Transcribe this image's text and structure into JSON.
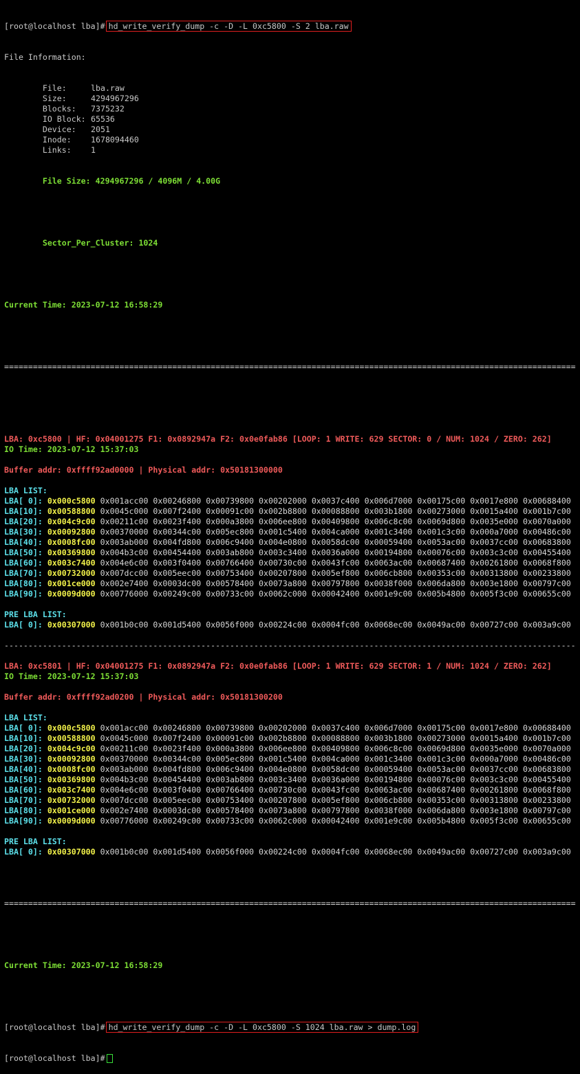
{
  "prompt": "[root@localhost lba]#",
  "command1": "hd_write_verify_dump -c -D -L 0xc5800 -S 2 lba.raw",
  "command2": "hd_write_verify_dump -c -D -L 0xc5800 -S 1024 lba.raw > dump.log",
  "file_info": {
    "header": "File Information:",
    "rows": [
      {
        "label": "        File:",
        "value": "lba.raw"
      },
      {
        "label": "        Size:",
        "value": "4294967296"
      },
      {
        "label": "        Blocks:",
        "value": "7375232"
      },
      {
        "label": "        IO Block:",
        "value": "65536"
      },
      {
        "label": "        Device:",
        "value": "2051"
      },
      {
        "label": "        Inode:",
        "value": "1678094460"
      },
      {
        "label": "        Links:",
        "value": "1"
      }
    ],
    "file_size": "        File Size: 4294967296 / 4096M / 4.00G",
    "sector_per_cluster": "        Sector_Per_Cluster: 1024"
  },
  "current_time": "Current Time: 2023-07-12 16:58:29",
  "separator_eq": "=======================================================================================================================",
  "separator_dash": "-----------------------------------------------------------------------------------------------------------------------",
  "lba_list_label": "LBA LIST:",
  "pre_lba_list_label": "PRE LBA LIST:",
  "lba_row_labels": [
    "LBA[ 0]:",
    "LBA[10]:",
    "LBA[20]:",
    "LBA[30]:",
    "LBA[40]:",
    "LBA[50]:",
    "LBA[60]:",
    "LBA[70]:",
    "LBA[80]:",
    "LBA[90]:"
  ],
  "lba_rows": [
    [
      "0x000c5800",
      "0x001acc00",
      "0x00246800",
      "0x00739800",
      "0x00202000",
      "0x0037c400",
      "0x006d7000",
      "0x00175c00",
      "0x0017e800",
      "0x00688400"
    ],
    [
      "0x00588800",
      "0x0045c000",
      "0x007f2400",
      "0x00091c00",
      "0x002b8800",
      "0x00088800",
      "0x003b1800",
      "0x00273000",
      "0x0015a400",
      "0x001b7c00"
    ],
    [
      "0x004c9c00",
      "0x00211c00",
      "0x0023f400",
      "0x000a3800",
      "0x006ee800",
      "0x00409800",
      "0x006c8c00",
      "0x0069d800",
      "0x0035e000",
      "0x0070a000"
    ],
    [
      "0x00092800",
      "0x00370000",
      "0x00344c00",
      "0x005ec800",
      "0x001c5400",
      "0x004ca000",
      "0x001c3400",
      "0x001c3c00",
      "0x000a7000",
      "0x00486c00"
    ],
    [
      "0x0008fc00",
      "0x003ab000",
      "0x004fd800",
      "0x006c9400",
      "0x004e0800",
      "0x0058dc00",
      "0x00059400",
      "0x0053ac00",
      "0x0037cc00",
      "0x00683800"
    ],
    [
      "0x00369800",
      "0x004b3c00",
      "0x00454400",
      "0x003ab800",
      "0x003c3400",
      "0x0036a000",
      "0x00194800",
      "0x00076c00",
      "0x003c3c00",
      "0x00455400"
    ],
    [
      "0x003c7400",
      "0x004e6c00",
      "0x003f0400",
      "0x00766400",
      "0x00730c00",
      "0x0043fc00",
      "0x0063ac00",
      "0x00687400",
      "0x00261800",
      "0x0068f800"
    ],
    [
      "0x00732000",
      "0x007dcc00",
      "0x005eec00",
      "0x00753400",
      "0x00207800",
      "0x005ef800",
      "0x006cb800",
      "0x00353c00",
      "0x00313800",
      "0x00233800"
    ],
    [
      "0x001ce000",
      "0x002e7400",
      "0x0003dc00",
      "0x00578400",
      "0x0073a800",
      "0x00797800",
      "0x0038f000",
      "0x006da800",
      "0x003e1800",
      "0x00797c00"
    ],
    [
      "0x0009d000",
      "0x00776000",
      "0x00249c00",
      "0x00733c00",
      "0x0062c000",
      "0x00042400",
      "0x001e9c00",
      "0x005b4800",
      "0x005f3c00",
      "0x00655c00"
    ]
  ],
  "pre_lba_label": "LBA[ 0]:",
  "pre_lba_row": [
    "0x00307000",
    "0x001b0c00",
    "0x001d5400",
    "0x0056f000",
    "0x00224c00",
    "0x0004fc00",
    "0x0068ec00",
    "0x0049ac00",
    "0x00727c00",
    "0x003a9c00"
  ],
  "blocks": [
    {
      "header": "LBA: 0xc5800 | HF: 0x04001275 F1: 0x0892947a F2: 0x0e0fab86 [LOOP: 1 WRITE: 629 SECTOR: 0 / NUM: 1024 / ZERO: 262]",
      "io_time": "IO Time: 2023-07-12 15:37:03",
      "buffer": "Buffer addr: 0xffff92ad0000 | Physical addr: 0x50181300000"
    },
    {
      "header": "LBA: 0xc5801 | HF: 0x04001275 F1: 0x0892947a F2: 0x0e0fab86 [LOOP: 1 WRITE: 629 SECTOR: 1 / NUM: 1024 / ZERO: 262]",
      "io_time": "IO Time: 2023-07-12 15:37:03",
      "buffer": "Buffer addr: 0xffff92ad0200 | Physical addr: 0x50181300200"
    }
  ],
  "colors": {
    "background": "#000000",
    "text": "#c8c8c8",
    "green": "#7dde35",
    "red": "#ef5a5a",
    "cyan": "#5ce0ea",
    "yellow": "#f2f24a",
    "highlight_border": "#e11f1f"
  }
}
